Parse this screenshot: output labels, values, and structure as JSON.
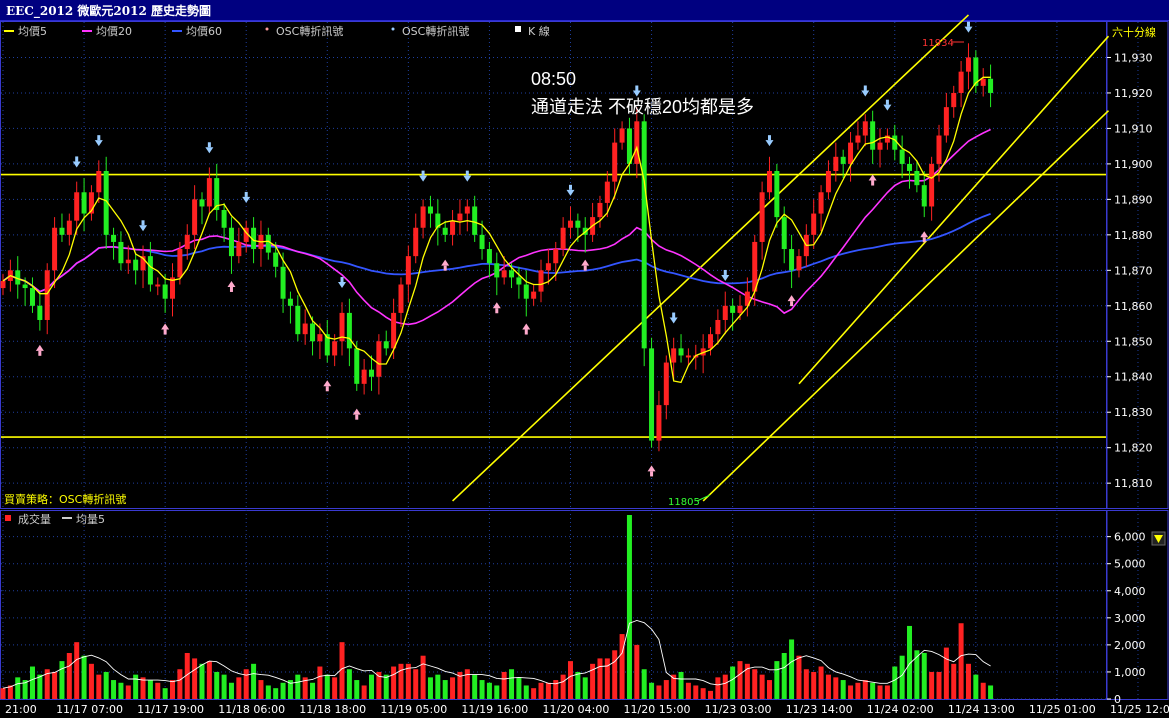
{
  "window": {
    "title": "EEC_2012 微歐元2012  歷史走勢圖"
  },
  "main_panel": {
    "period_label": "六十分線",
    "legend": [
      {
        "label": "均價5",
        "color": "#ffff00",
        "icon": "line-swatch"
      },
      {
        "label": "均價20",
        "color": "#ff33ff",
        "icon": "line-swatch"
      },
      {
        "label": "均價60",
        "color": "#3355ff",
        "icon": "line-swatch"
      },
      {
        "label": "OSC轉折訊號",
        "color": "#ff9999",
        "icon": "dot-swatch"
      },
      {
        "label": "OSC轉折訊號",
        "color": "#99ccff",
        "icon": "dot-swatch"
      },
      {
        "label": "K 線",
        "color": "#ffffff",
        "icon": "square-swatch"
      }
    ],
    "annotation_time": "08:50",
    "annotation_text": "通道走法 不破穩20均都是多",
    "strategy_label": "買賣策略：OSC轉折訊號",
    "high_label": "11934",
    "low_label": "11805",
    "y_ticks": [
      "11,810",
      "11,820",
      "11,830",
      "11,840",
      "11,850",
      "11,860",
      "11,870",
      "11,880",
      "11,890",
      "11,900",
      "11,910",
      "11,920",
      "11,930"
    ],
    "horizontal_lines": [
      11897,
      11823
    ]
  },
  "volume_panel": {
    "legend": [
      {
        "label": "成交量",
        "color": "#ff2222",
        "icon": "square-swatch"
      },
      {
        "label": "均量5",
        "color": "#ffffff",
        "icon": "line-swatch"
      }
    ],
    "y_ticks": [
      "0",
      "1,000",
      "2,000",
      "3,000",
      "4,000",
      "5,000",
      "6,000"
    ],
    "dropdown_icon": "triangle-down-icon"
  },
  "x_axis": {
    "ticks": [
      "21:00",
      "11/17 07:00",
      "11/17 19:00",
      "11/18 06:00",
      "11/18 18:00",
      "11/19 05:00",
      "11/19 16:00",
      "11/20 04:00",
      "11/20 15:00",
      "11/23 03:00",
      "11/23 14:00",
      "11/24 02:00",
      "11/24 13:00",
      "11/25 01:00",
      "11/25 12:00"
    ]
  },
  "chart_data": {
    "type": "candlestick",
    "title": "EEC_2012 微歐元2012  歷史走勢圖",
    "timeframe": "六十分線",
    "ylim": [
      11803,
      11940
    ],
    "volume_ylim": [
      0,
      6800
    ],
    "x_tick_labels": [
      "21:00",
      "11/17 07:00",
      "11/17 19:00",
      "11/18 06:00",
      "11/18 18:00",
      "11/19 05:00",
      "11/19 16:00",
      "11/20 04:00",
      "11/20 15:00",
      "11/23 03:00",
      "11/23 14:00",
      "11/24 02:00",
      "11/24 13:00",
      "11/25 01:00",
      "11/25 12:00"
    ],
    "bars_per_tick": 11,
    "close": [
      11867,
      11870,
      11866,
      11865,
      11860,
      11856,
      11870,
      11882,
      11880,
      11884,
      11892,
      11886,
      11892,
      11898,
      11880,
      11878,
      11872,
      11873,
      11870,
      11874,
      11866,
      11866,
      11862,
      11868,
      11876,
      11880,
      11890,
      11888,
      11896,
      11887,
      11882,
      11874,
      11878,
      11882,
      11876,
      11880,
      11875,
      11871,
      11862,
      11860,
      11852,
      11855,
      11850,
      11852,
      11846,
      11850,
      11858,
      11848,
      11838,
      11842,
      11840,
      11850,
      11848,
      11858,
      11866,
      11874,
      11882,
      11888,
      11886,
      11882,
      11880,
      11884,
      11886,
      11888,
      11880,
      11876,
      11872,
      11868,
      11870,
      11868,
      11866,
      11862,
      11864,
      11870,
      11872,
      11876,
      11882,
      11884,
      11882,
      11880,
      11885,
      11889,
      11895,
      11906,
      11910,
      11900,
      11912,
      11848,
      11822,
      11832,
      11844,
      11848,
      11846,
      11846,
      11846,
      11848,
      11852,
      11856,
      11860,
      11858,
      11860,
      11864,
      11878,
      11892,
      11898,
      11885,
      11876,
      11870,
      11874,
      11880,
      11886,
      11892,
      11898,
      11902,
      11900,
      11906,
      11908,
      11912,
      11904,
      11906,
      11908,
      11904,
      11900,
      11898,
      11894,
      11888,
      11900,
      11908,
      11916,
      11920,
      11926,
      11930,
      11922,
      11924,
      11920
    ],
    "high_marker": 11934,
    "low_marker": 11805,
    "horizontal_lines": [
      11897,
      11823
    ],
    "series": [
      {
        "name": "均價5",
        "color": "#ffff00"
      },
      {
        "name": "均價20",
        "color": "#ff33ff"
      },
      {
        "name": "均價60",
        "color": "#3355ff"
      }
    ],
    "volume": [
      400,
      500,
      800,
      700,
      1200,
      900,
      1100,
      1000,
      1400,
      1700,
      2100,
      1600,
      1300,
      900,
      1000,
      700,
      600,
      500,
      900,
      800,
      700,
      600,
      400,
      700,
      1100,
      1700,
      1500,
      1300,
      1400,
      1000,
      900,
      600,
      800,
      1100,
      1300,
      700,
      500,
      400,
      600,
      700,
      900,
      800,
      600,
      1200,
      900,
      800,
      2100,
      1100,
      700,
      500,
      900,
      1000,
      900,
      1200,
      1300,
      1300,
      1100,
      1600,
      800,
      900,
      700,
      800,
      1000,
      1100,
      900,
      700,
      600,
      500,
      1000,
      1100,
      800,
      500,
      400,
      600,
      600,
      700,
      900,
      1400,
      1000,
      800,
      1300,
      1500,
      1500,
      1800,
      2400,
      6800,
      2000,
      1100,
      600,
      500,
      700,
      900,
      1000,
      600,
      500,
      400,
      300,
      800,
      900,
      1200,
      1400,
      1300,
      1100,
      900,
      700,
      1400,
      1700,
      2200,
      1600,
      1100,
      1000,
      1200,
      900,
      800,
      700,
      500,
      600,
      700,
      600,
      500,
      500,
      1200,
      1600,
      2700,
      1800,
      1700,
      1000,
      1000,
      1900,
      1300,
      2800,
      1300,
      900,
      600,
      500,
      400,
      300,
      400
    ]
  }
}
